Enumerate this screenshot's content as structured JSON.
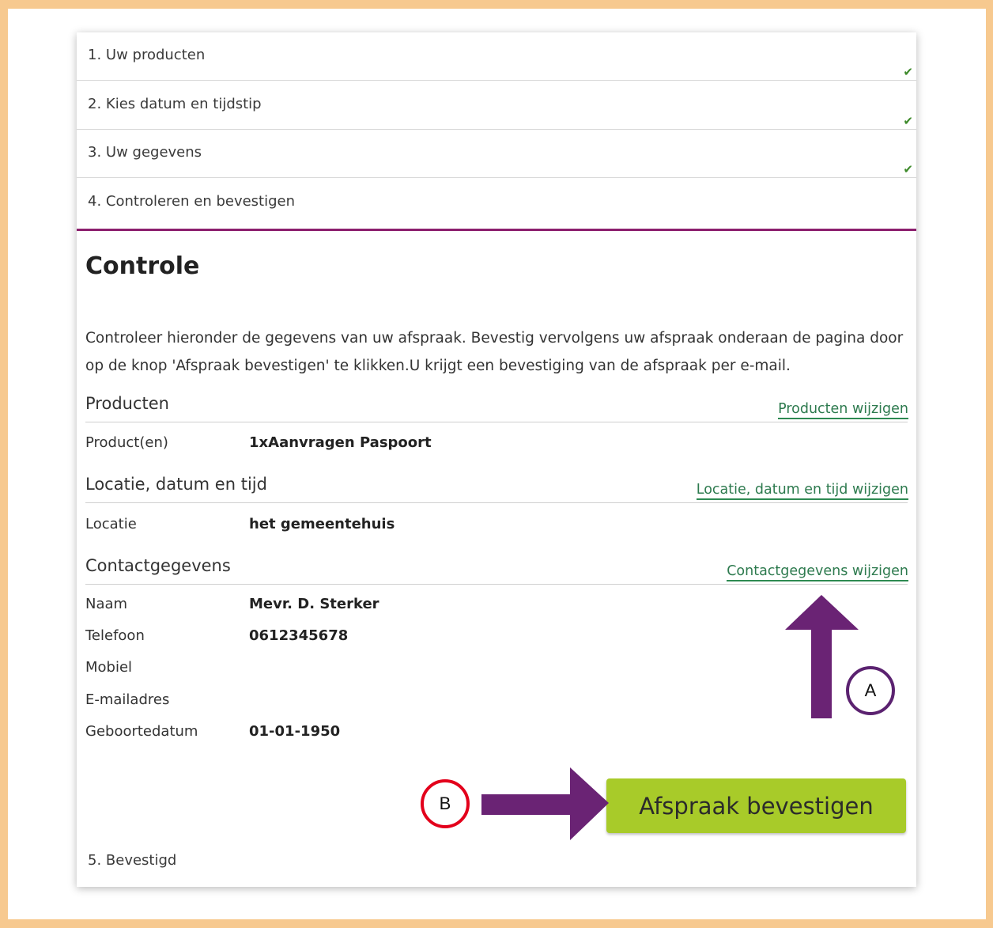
{
  "steps": [
    {
      "label": "1. Uw producten",
      "done": true
    },
    {
      "label": "2. Kies datum en tijdstip",
      "done": true
    },
    {
      "label": "3. Uw gegevens",
      "done": true
    },
    {
      "label": "4. Controleren en bevestigen",
      "done": false
    }
  ],
  "check_glyph": "✔",
  "main": {
    "title": "Controle",
    "intro": "Controleer hieronder de gegevens van uw afspraak. Bevestig vervolgens uw afspraak onderaan de pagina door op de knop 'Afspraak bevestigen' te klikken.U krijgt een bevestiging van de afspraak per e-mail."
  },
  "sections": {
    "producten": {
      "title": "Producten",
      "link": "Producten wijzigen",
      "rows": [
        {
          "label": "Product(en)",
          "value": "1xAanvragen Paspoort"
        }
      ]
    },
    "locatie": {
      "title": "Locatie, datum en tijd",
      "link": "Locatie, datum en tijd wijzigen",
      "rows": [
        {
          "label": "Locatie",
          "value": "het gemeentehuis"
        }
      ]
    },
    "contact": {
      "title": "Contactgegevens",
      "link": "Contactgegevens wijzigen",
      "rows": [
        {
          "label": "Naam",
          "value": "Mevr. D. Sterker"
        },
        {
          "label": "Telefoon",
          "value": "0612345678"
        },
        {
          "label": "Mobiel",
          "value": ""
        },
        {
          "label": "E-mailadres",
          "value": ""
        },
        {
          "label": "Geboortedatum",
          "value": "01-01-1950"
        }
      ]
    }
  },
  "confirm_button": "Afspraak bevestigen",
  "step5": "5. Bevestigd",
  "annotations": {
    "a": "A",
    "b": "B",
    "arrow_color": "#6a2374",
    "a_ring_color": "#5b2270",
    "b_ring_color": "#e3001b"
  },
  "colors": {
    "frame": "#f7c98f",
    "accent_line": "#8c1f6e",
    "link": "#2d7a4e",
    "button": "#a8cb29",
    "check": "#3d8a2a"
  }
}
